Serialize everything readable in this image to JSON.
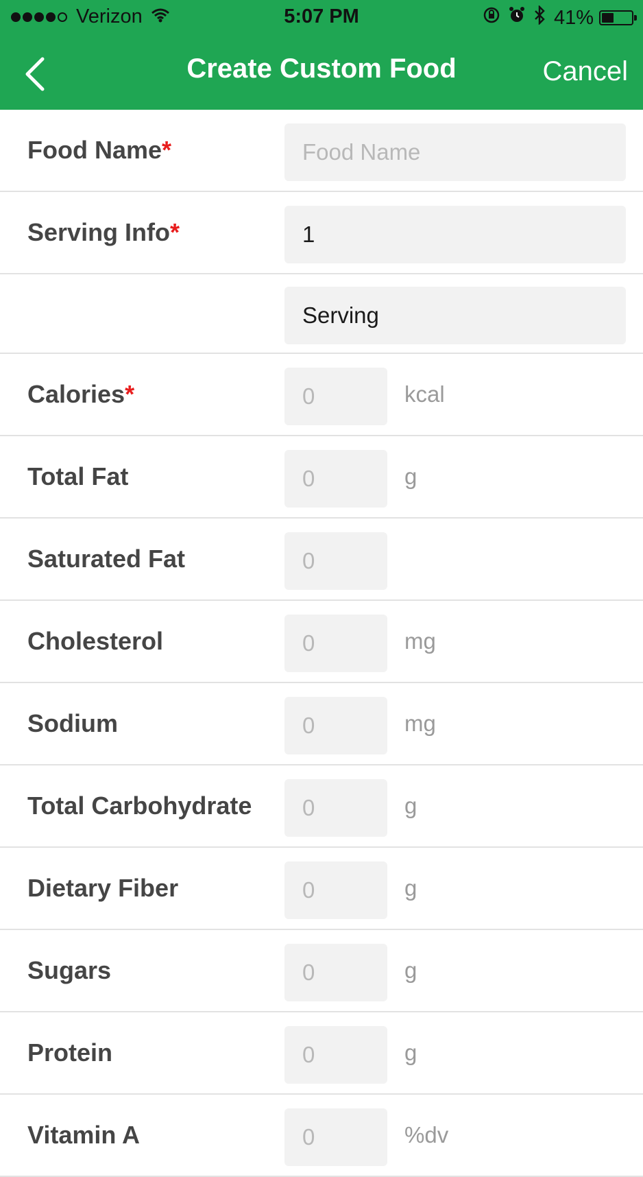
{
  "status_bar": {
    "carrier": "Verizon",
    "time": "5:07 PM",
    "battery_percent": "41%",
    "battery_level": 0.41,
    "signal_bars": 4,
    "signal_max": 5,
    "icons": [
      "wifi-icon",
      "rotation-lock-icon",
      "alarm-icon",
      "bluetooth-icon",
      "battery-icon"
    ]
  },
  "nav": {
    "back_icon": "chevron-left-icon",
    "title": "Create Custom Food",
    "cancel_label": "Cancel"
  },
  "colors": {
    "brand_green": "#1fa653",
    "required_red": "#e81d1d"
  },
  "form": {
    "food_name": {
      "label": "Food Name",
      "required_mark": "*",
      "placeholder": "Food Name",
      "value": ""
    },
    "serving_info": {
      "label": "Serving Info",
      "required_mark": "*",
      "value": "1"
    },
    "serving_unit": {
      "value": "Serving"
    },
    "calories": {
      "label": "Calories",
      "required_mark": "*",
      "placeholder": "0",
      "unit": "kcal"
    },
    "total_fat": {
      "label": "Total Fat",
      "placeholder": "0",
      "unit": "g"
    },
    "saturated_fat": {
      "label": "Saturated Fat",
      "placeholder": "0",
      "unit": ""
    },
    "cholesterol": {
      "label": "Cholesterol",
      "placeholder": "0",
      "unit": "mg"
    },
    "sodium": {
      "label": "Sodium",
      "placeholder": "0",
      "unit": "mg"
    },
    "total_carbohydrate": {
      "label": "Total Carbohydrate",
      "placeholder": "0",
      "unit": "g"
    },
    "dietary_fiber": {
      "label": "Dietary Fiber",
      "placeholder": "0",
      "unit": "g"
    },
    "sugars": {
      "label": "Sugars",
      "placeholder": "0",
      "unit": "g"
    },
    "protein": {
      "label": "Protein",
      "placeholder": "0",
      "unit": "g"
    },
    "vitamin_a": {
      "label": "Vitamin A",
      "placeholder": "0",
      "unit": "%dv"
    }
  }
}
